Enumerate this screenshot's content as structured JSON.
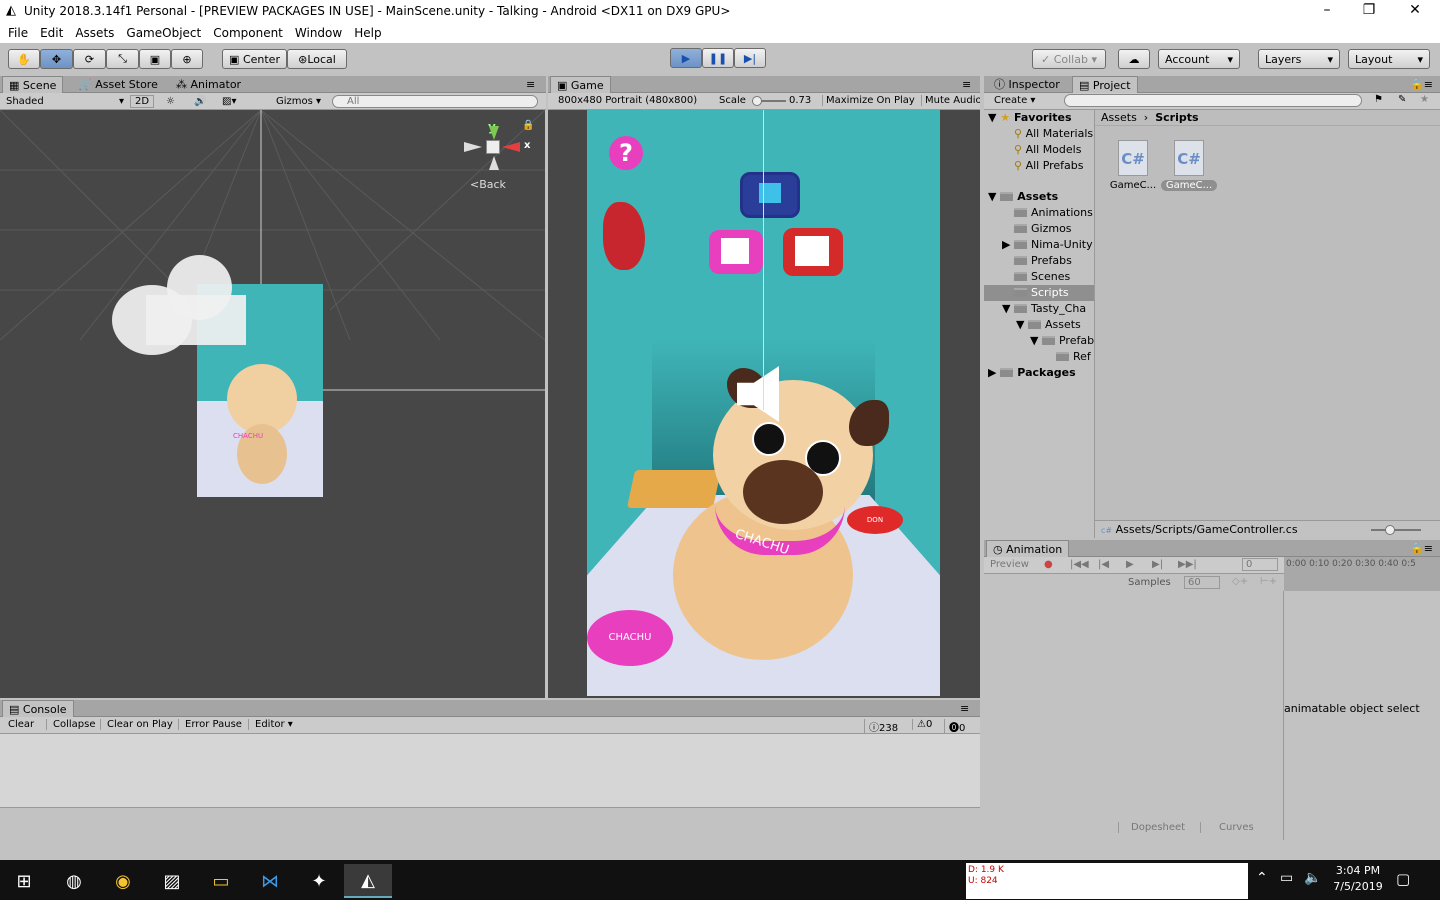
{
  "title_bar": {
    "title": "Unity 2018.3.14f1 Personal - [PREVIEW PACKAGES IN USE] - MainScene.unity - Talking - Android <DX11 on DX9 GPU>",
    "minimize": "–",
    "maximize": "❐",
    "close": "✕"
  },
  "menu": [
    "File",
    "Edit",
    "Assets",
    "GameObject",
    "Component",
    "Window",
    "Help"
  ],
  "toolbar": {
    "pivot": "Center",
    "space": "Local",
    "collab": "Collab",
    "account": "Account",
    "layers": "Layers",
    "layout": "Layout"
  },
  "scene_panel": {
    "tabs": [
      "Scene",
      "Asset Store",
      "Animator"
    ],
    "shading": "Shaded",
    "mode_2d": "2D",
    "gizmos": "Gizmos",
    "search_placeholder": "All",
    "back_label": "Back",
    "gizmo_x": "x",
    "gizmo_y": "y"
  },
  "game_panel": {
    "tab": "Game",
    "resolution": "800x480 Portrait (480x800)",
    "scale_label": "Scale",
    "scale_value": "0.73",
    "maximize": "Maximize On Play",
    "mute": "Mute Audio",
    "question": "?",
    "collar_text": "CHACHU",
    "bowl_text": "CHACHU",
    "bowl2_text": "DON"
  },
  "project_panel": {
    "tabs": [
      "Inspector",
      "Project"
    ],
    "create": "Create",
    "favorites_label": "Favorites",
    "favorites": [
      "All Materials",
      "All Models",
      "All Prefabs"
    ],
    "assets_label": "Assets",
    "assets": [
      "Animations",
      "Gizmos",
      "Nima-Unity",
      "Prefabs",
      "Scenes",
      "Scripts",
      "Tasty_Cha"
    ],
    "tasty_children": [
      "Assets",
      "Prefab",
      "Ref"
    ],
    "packages_label": "Packages",
    "breadcrumb": [
      "Assets",
      "Scripts"
    ],
    "files": [
      "GameC...",
      "GameC..."
    ],
    "file_icon": "C#",
    "status_path": "Assets/Scripts/GameController.cs"
  },
  "console_panel": {
    "tab": "Console",
    "buttons": [
      "Clear",
      "Collapse",
      "Clear on Play",
      "Error Pause",
      "Editor"
    ],
    "counts": {
      "info": "238",
      "warning": "0",
      "error": "0"
    }
  },
  "animation_panel": {
    "tab": "Animation",
    "preview": "Preview",
    "frame": "0",
    "samples_label": "Samples",
    "samples_value": "60",
    "timeline": "0:00 0:10 0:20 0:30 0:40 0:5",
    "message": "animatable object select",
    "dopesheet": "Dopesheet",
    "curves": "Curves"
  },
  "taskbar": {
    "time": "3:04 PM",
    "date": "7/5/2019",
    "net_d": "D: 1.9 K",
    "net_u": "U: 824"
  },
  "colors": {
    "teal": "#3fb5b8",
    "pink": "#e83fbf",
    "play_blue": "#4a82d6"
  }
}
